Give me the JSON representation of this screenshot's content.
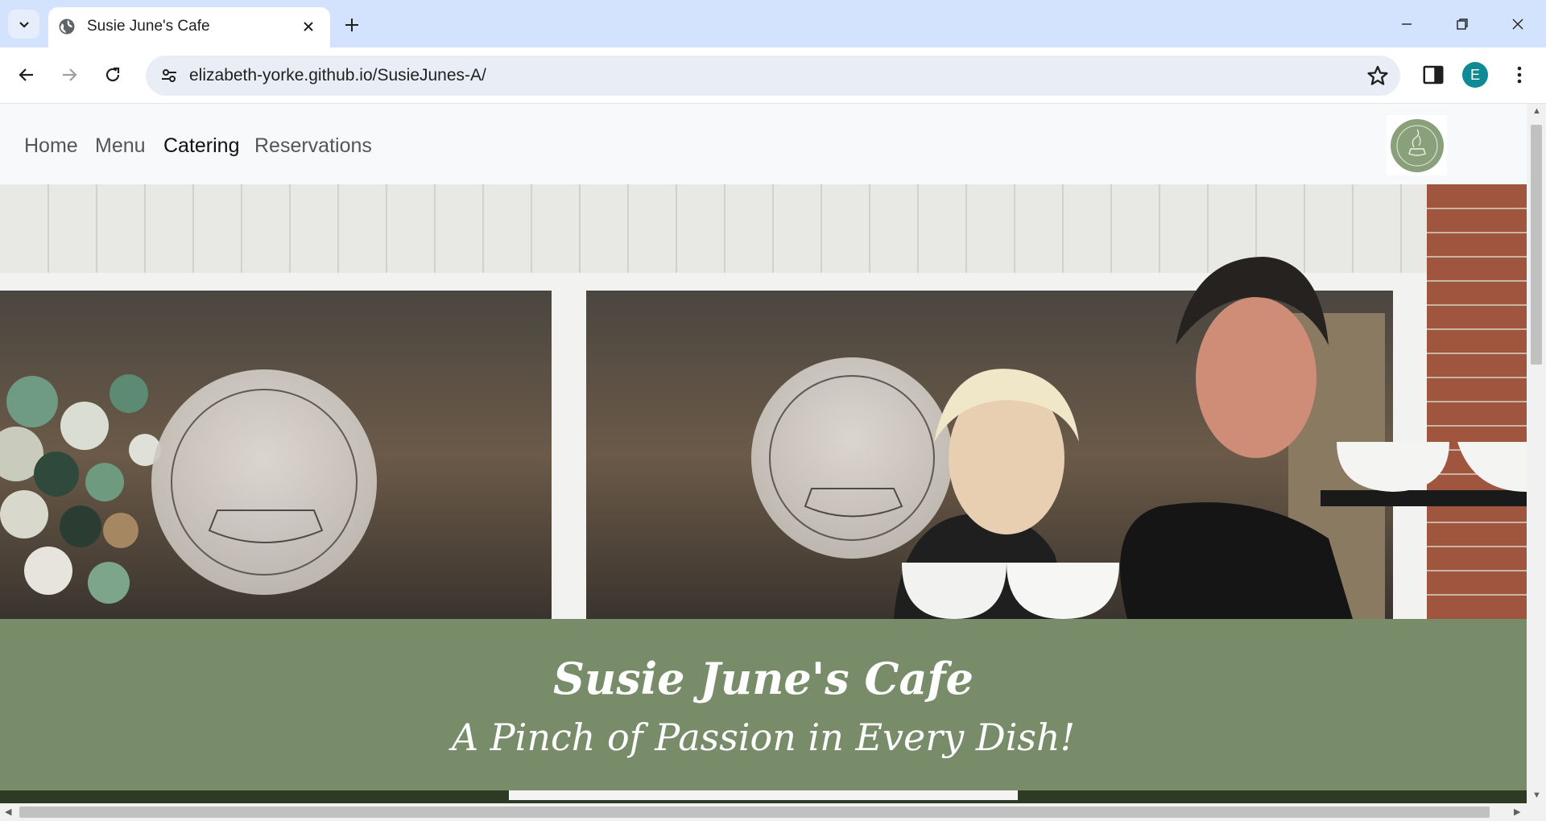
{
  "browser": {
    "tab_title": "Susie June's Cafe",
    "url": "elizabeth-yorke.github.io/SusieJunes-A/",
    "profile_initial": "E",
    "icons": [
      "tab-search-icon",
      "globe-icon",
      "close-icon",
      "plus-icon",
      "minimize-icon",
      "restore-icon",
      "close-window-icon",
      "back-icon",
      "forward-icon",
      "reload-icon",
      "site-info-icon",
      "star-icon",
      "side-panel-icon",
      "more-icon"
    ]
  },
  "site": {
    "nav": {
      "links": [
        "Home",
        "Menu",
        "Catering",
        "Reservations"
      ],
      "active": "Catering"
    },
    "hero": {
      "title": "Susie June's Cafe",
      "tagline": "A Pinch of Passion in Every Dish!"
    },
    "colors": {
      "banner": "#788c69",
      "nav_bg": "#f8f9fa",
      "strip": "#2e3b24"
    }
  }
}
